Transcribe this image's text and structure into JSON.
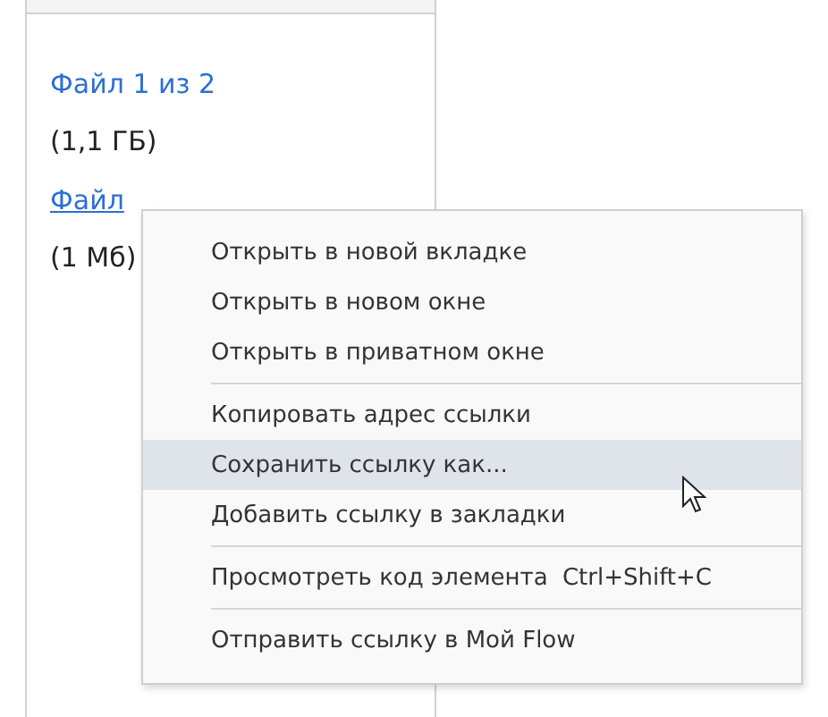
{
  "files": [
    {
      "link": "Файл 1 из 2",
      "hovered": false,
      "size": "(1,1 ГБ)"
    },
    {
      "link": "Файл",
      "hovered": true,
      "size": "(1 Мб)"
    }
  ],
  "context_menu": {
    "groups": [
      [
        {
          "label": "Открыть в новой вкладке",
          "selected": false
        },
        {
          "label": "Открыть в новом окне",
          "selected": false
        },
        {
          "label": "Открыть в приватном окне",
          "selected": false
        }
      ],
      [
        {
          "label": "Копировать адрес ссылки",
          "selected": false
        },
        {
          "label": "Сохранить ссылку как...",
          "selected": true
        },
        {
          "label": "Добавить ссылку в закладки",
          "selected": false
        }
      ],
      [
        {
          "label": "Просмотреть код элемента",
          "shortcut": "Ctrl+Shift+C",
          "selected": false
        }
      ],
      [
        {
          "label": "Отправить ссылку в Мой Flow",
          "selected": false
        }
      ]
    ]
  }
}
